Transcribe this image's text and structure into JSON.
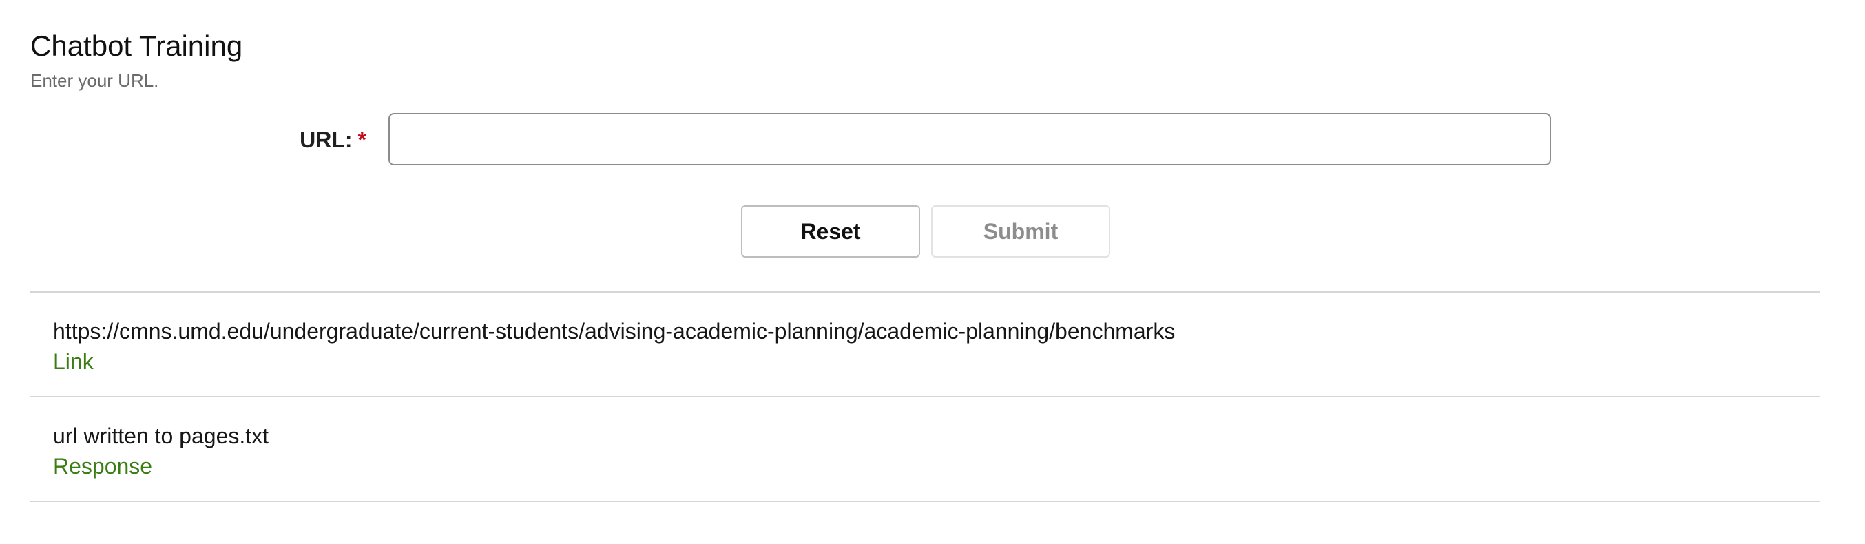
{
  "header": {
    "title": "Chatbot Training",
    "subtitle": "Enter your URL."
  },
  "form": {
    "url_label": "URL:",
    "required_marker": "*",
    "url_value": "",
    "url_placeholder": ""
  },
  "actions": {
    "reset_label": "Reset",
    "submit_label": "Submit"
  },
  "results": [
    {
      "text": "https://cmns.umd.edu/undergraduate/current-students/advising-academic-planning/academic-planning/benchmarks",
      "kind": "Link"
    },
    {
      "text": "url written to pages.txt",
      "kind": "Response"
    }
  ],
  "colors": {
    "accent_green": "#3a7d14",
    "required_red": "#c40d1e",
    "disabled_text": "#8d8d8d"
  }
}
